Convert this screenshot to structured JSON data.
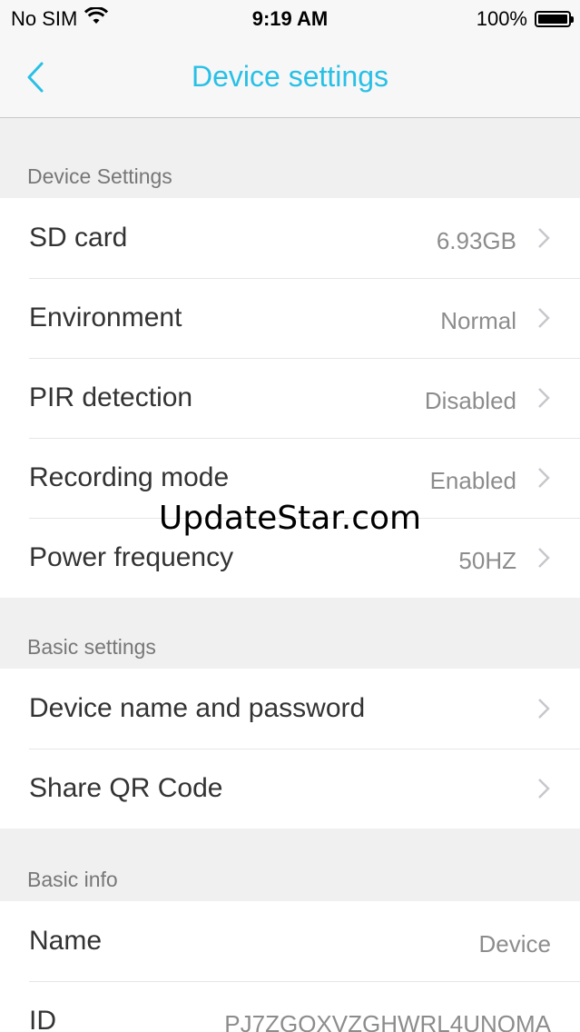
{
  "status_bar": {
    "carrier": "No SIM",
    "time": "9:19 AM",
    "battery": "100%",
    "battery_level": 1.0
  },
  "nav": {
    "title": "Device settings",
    "back_icon": "chevron-left-icon",
    "accent_color": "#29c0e6"
  },
  "sections": {
    "device_settings": {
      "header": "Device Settings",
      "rows": [
        {
          "label": "SD card",
          "value": "6.93GB"
        },
        {
          "label": "Environment",
          "value": "Normal"
        },
        {
          "label": "PIR detection",
          "value": "Disabled"
        },
        {
          "label": "Recording mode",
          "value": "Enabled"
        },
        {
          "label": "Power frequency",
          "value": "50HZ"
        }
      ]
    },
    "basic_settings": {
      "header": "Basic settings",
      "rows": [
        {
          "label": "Device name and password"
        },
        {
          "label": "Share QR Code"
        }
      ]
    },
    "basic_info": {
      "header": "Basic info",
      "rows": [
        {
          "label": "Name",
          "value": "Device"
        },
        {
          "label": "ID",
          "value": "PJ7ZGOXVZGHWRL4UNQMA"
        }
      ]
    }
  },
  "watermark": "UpdateStar.com"
}
